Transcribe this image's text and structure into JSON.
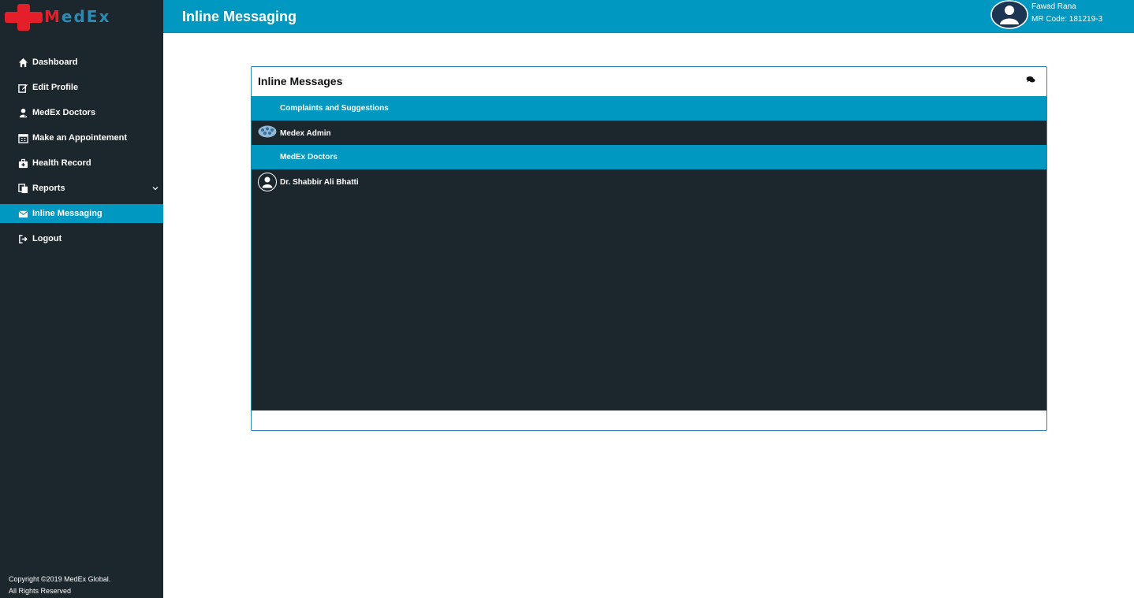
{
  "app": {
    "logo_text_m": "M",
    "logo_text_rest": "edEx",
    "brand_color": "#0097c1",
    "logo_red": "#e51f2a"
  },
  "header": {
    "title": "Inline Messaging",
    "user_name": "Fawad Rana",
    "mr_code": "MR Code: 181219-3"
  },
  "sidebar": {
    "items": [
      {
        "label": "Dashboard",
        "icon": "home-icon"
      },
      {
        "label": "Edit Profile",
        "icon": "edit-icon"
      },
      {
        "label": "MedEx Doctors",
        "icon": "doctor-icon"
      },
      {
        "label": "Make an Appointement",
        "icon": "calendar-icon"
      },
      {
        "label": "Health Record",
        "icon": "medkit-icon"
      },
      {
        "label": "Reports",
        "icon": "copy-icon"
      },
      {
        "label": "Inline Messaging",
        "icon": "envelope-icon",
        "active": true
      },
      {
        "label": "Logout",
        "icon": "sign-out-icon"
      }
    ],
    "copyright_line1": "Copyright ©2019 MedEx Global.",
    "copyright_line2": "All Rights Reserved"
  },
  "messages": {
    "title": "Inline Messages",
    "header_icon": "comments-icon",
    "groups": [
      {
        "name": "Complaints and Suggestions",
        "contacts": [
          {
            "name": "Medex Admin",
            "avatar": "group-avatar-icon"
          }
        ]
      },
      {
        "name": "MedEx Doctors",
        "contacts": [
          {
            "name": "Dr. Shabbir Ali Bhatti",
            "avatar": "user-avatar-icon"
          }
        ]
      }
    ]
  }
}
